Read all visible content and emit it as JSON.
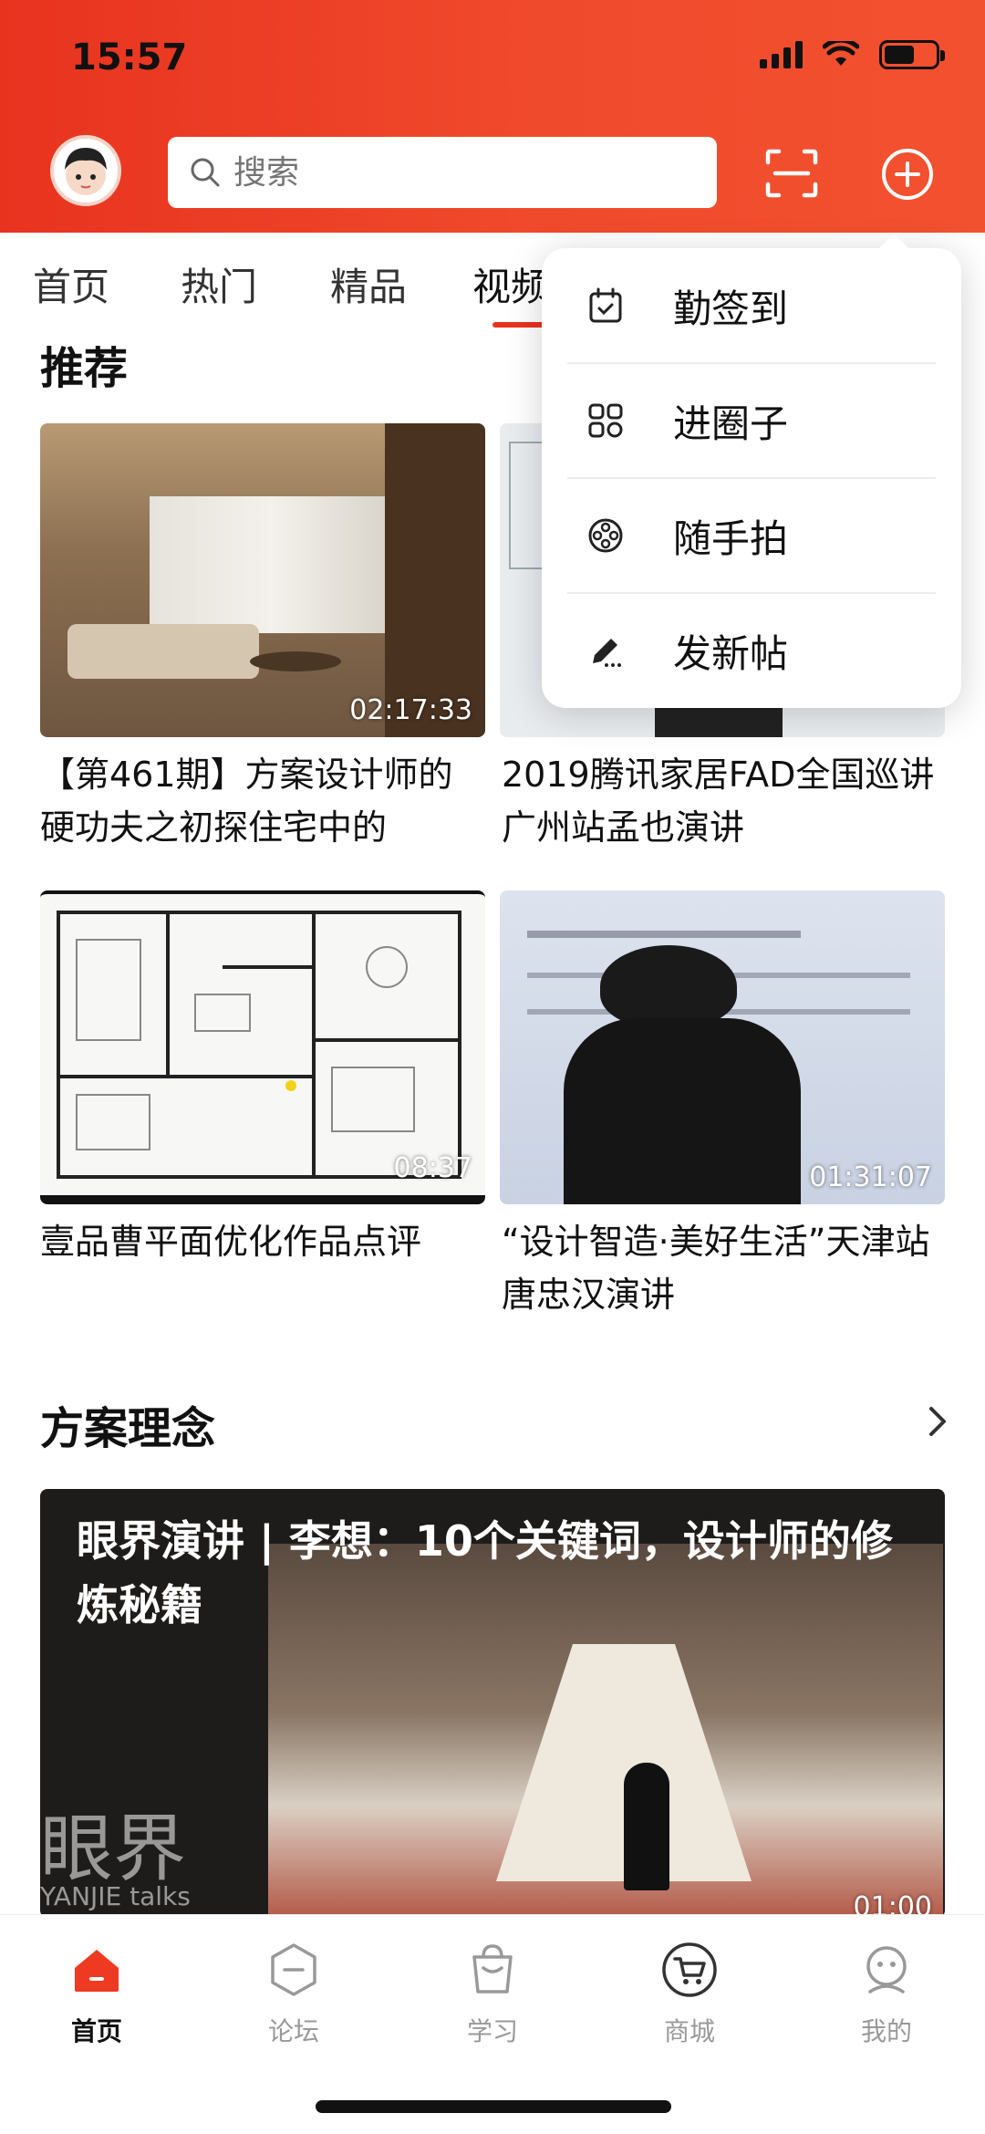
{
  "status_bar": {
    "time": "15:57"
  },
  "search": {
    "placeholder": "搜索"
  },
  "tabs": [
    {
      "label": "首页"
    },
    {
      "label": "热门"
    },
    {
      "label": "精品"
    },
    {
      "label": "视频"
    }
  ],
  "recommend": {
    "title": "推荐",
    "videos": [
      {
        "title": "【第461期】方案设计师的硬功夫之初探住宅中的",
        "duration": "02:17:33"
      },
      {
        "title": "2019腾讯家居FAD全国巡讲广州站孟也演讲",
        "duration": ""
      },
      {
        "title": "壹品曹平面优化作品点评",
        "duration": "08:37"
      },
      {
        "title": "“设计智造·美好生活”天津站 唐忠汉演讲",
        "duration": "01:31:07"
      }
    ]
  },
  "concept": {
    "title": "方案理念",
    "banner": {
      "title": "眼界演讲 | 李想：10个关键词，设计师的修炼秘籍",
      "watermark": "眼界",
      "watermark_sub": "YANJIE talks",
      "duration": "01:00"
    }
  },
  "menu": {
    "items": [
      {
        "label": "勤签到",
        "icon": "calendar-check-icon"
      },
      {
        "label": "进圈子",
        "icon": "grid-circles-icon"
      },
      {
        "label": "随手拍",
        "icon": "film-reel-icon"
      },
      {
        "label": "发新帖",
        "icon": "pen-icon"
      }
    ]
  },
  "bottom_nav": {
    "items": [
      {
        "label": "首页",
        "icon": "home-icon",
        "active": true
      },
      {
        "label": "论坛",
        "icon": "forum-icon",
        "active": false
      },
      {
        "label": "学习",
        "icon": "bag-icon",
        "active": false
      },
      {
        "label": "商城",
        "icon": "cart-icon",
        "active": false
      },
      {
        "label": "我的",
        "icon": "profile-icon",
        "active": false
      }
    ]
  },
  "colors": {
    "accent": "#e8331f",
    "text": "#111111",
    "muted": "#999999"
  }
}
